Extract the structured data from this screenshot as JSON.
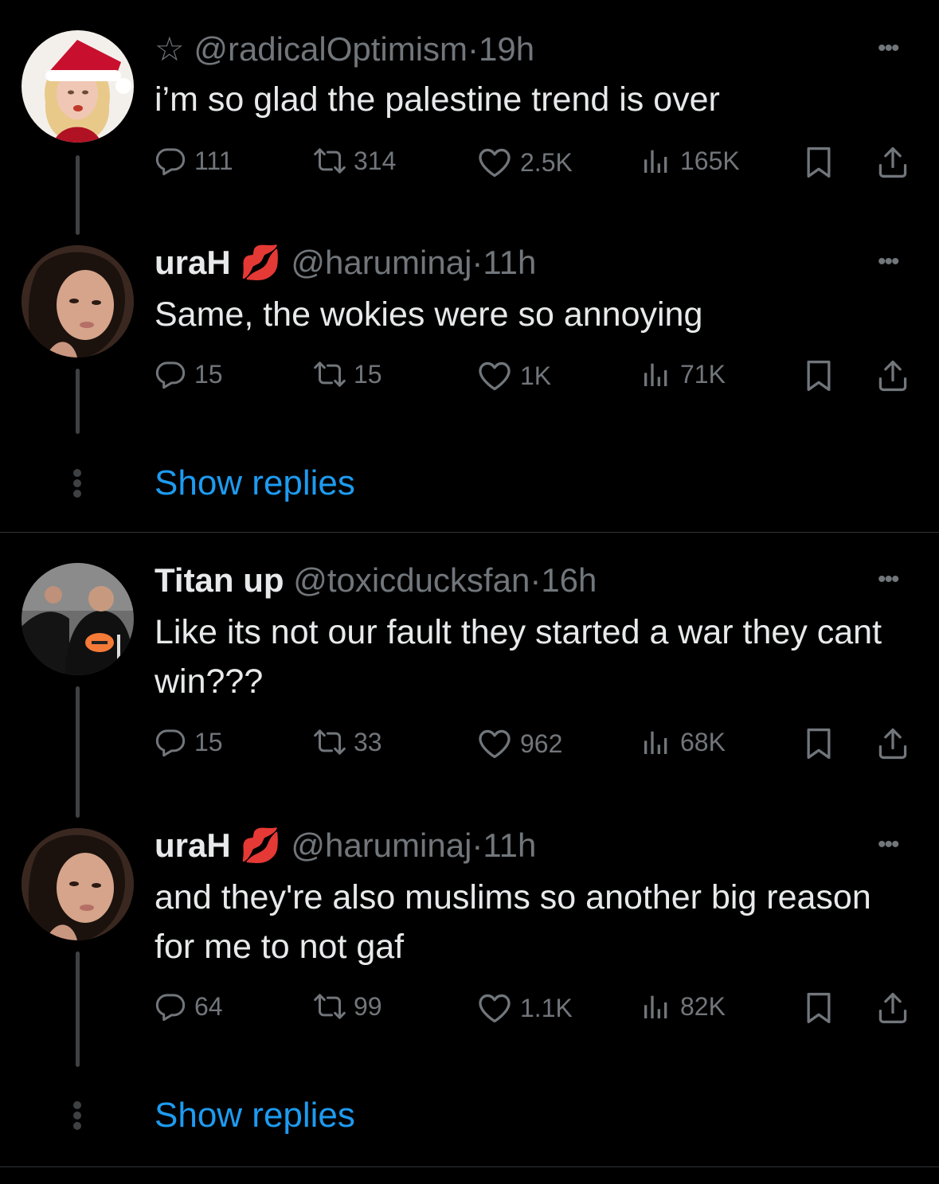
{
  "tweets": [
    {
      "name": "",
      "badge": "☆",
      "handle": "@radicalOptimism",
      "time": "19h",
      "text": "i’m so glad the palestine trend is over",
      "replies": "111",
      "retweets": "314",
      "likes": "2.5K",
      "views": "165K"
    },
    {
      "name": "uraH",
      "badge": "💋",
      "handle": "@haruminaj",
      "time": "11h",
      "text": "Same, the wokies were so annoying",
      "replies": "15",
      "retweets": "15",
      "likes": "1K",
      "views": "71K"
    },
    {
      "name": "Titan up",
      "badge": "",
      "handle": "@toxicducksfan",
      "time": "16h",
      "text": "Like its not our fault they started a war they cant win???",
      "replies": "15",
      "retweets": "33",
      "likes": "962",
      "views": "68K"
    },
    {
      "name": "uraH",
      "badge": "💋",
      "handle": "@haruminaj",
      "time": "11h",
      "text": "and they're also muslims so another big reason for me to not gaf",
      "replies": "64",
      "retweets": "99",
      "likes": "1.1K",
      "views": "82K"
    }
  ],
  "show_replies_label": "Show replies",
  "separator_dot": "·",
  "more_glyph": "•••",
  "colors": {
    "background": "#000000",
    "text": "#e7e9ea",
    "muted": "#71767b",
    "link": "#1d9bf0",
    "line": "#3e4144"
  },
  "icons": [
    "reply-icon",
    "retweet-icon",
    "like-icon",
    "views-icon",
    "bookmark-icon",
    "share-icon",
    "more-icon"
  ]
}
